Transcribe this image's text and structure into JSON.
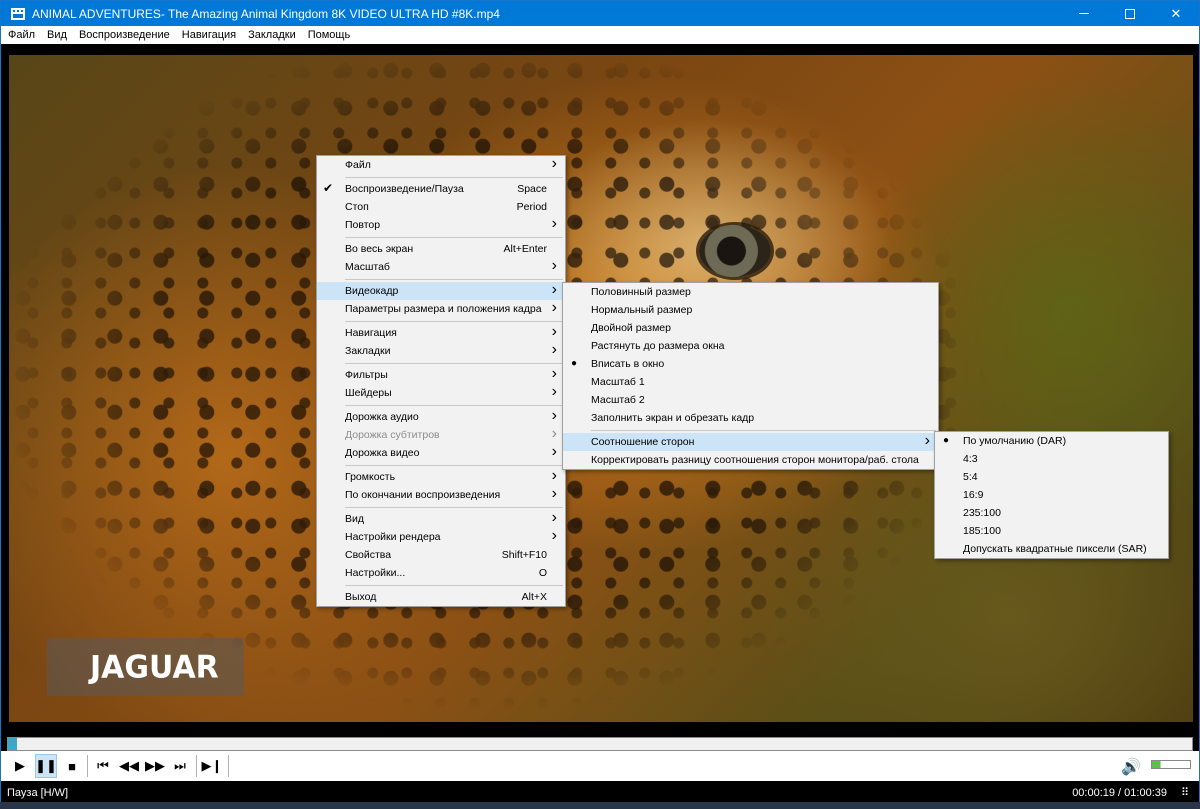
{
  "window": {
    "title": "ANIMAL ADVENTURES- The Amazing Animal Kingdom 8K VIDEO ULTRA HD #8K.mp4"
  },
  "menubar": [
    "Файл",
    "Вид",
    "Воспроизведение",
    "Навигация",
    "Закладки",
    "Помощь"
  ],
  "video": {
    "caption": "JAGUAR"
  },
  "main_menu": [
    {
      "label": "Файл",
      "submenu": true
    },
    {
      "divider": true
    },
    {
      "label": "Воспроизведение/Пауза",
      "shortcut": "Space",
      "checked": true
    },
    {
      "label": "Стоп",
      "shortcut": "Period"
    },
    {
      "label": "Повтор",
      "submenu": true
    },
    {
      "divider": true
    },
    {
      "label": "Во весь экран",
      "shortcut": "Alt+Enter"
    },
    {
      "label": "Масштаб",
      "submenu": true
    },
    {
      "divider": true
    },
    {
      "label": "Видеокадр",
      "submenu": true,
      "highlighted": true
    },
    {
      "label": "Параметры размера и положения кадра",
      "submenu": true
    },
    {
      "divider": true
    },
    {
      "label": "Навигация",
      "submenu": true
    },
    {
      "label": "Закладки",
      "submenu": true
    },
    {
      "divider": true
    },
    {
      "label": "Фильтры",
      "submenu": true
    },
    {
      "label": "Шейдеры",
      "submenu": true
    },
    {
      "divider": true
    },
    {
      "label": "Дорожка аудио",
      "submenu": true
    },
    {
      "label": "Дорожка субтитров",
      "submenu": true,
      "disabled": true
    },
    {
      "label": "Дорожка видео",
      "submenu": true
    },
    {
      "divider": true
    },
    {
      "label": "Громкость",
      "submenu": true
    },
    {
      "label": "По окончании воспроизведения",
      "submenu": true
    },
    {
      "divider": true
    },
    {
      "label": "Вид",
      "submenu": true
    },
    {
      "label": "Настройки рендера",
      "submenu": true
    },
    {
      "label": "Свойства",
      "shortcut": "Shift+F10"
    },
    {
      "label": "Настройки...",
      "shortcut": "O"
    },
    {
      "divider": true
    },
    {
      "label": "Выход",
      "shortcut": "Alt+X"
    }
  ],
  "video_menu": [
    {
      "label": "Половинный размер"
    },
    {
      "label": "Нормальный размер"
    },
    {
      "label": "Двойной размер"
    },
    {
      "label": "Растянуть до размера окна"
    },
    {
      "label": "Вписать в окно",
      "selected": true
    },
    {
      "label": "Масштаб 1"
    },
    {
      "label": "Масштаб 2"
    },
    {
      "label": "Заполнить экран и обрезать кадр"
    },
    {
      "divider": true
    },
    {
      "label": "Соотношение сторон",
      "submenu": true,
      "highlighted": true
    },
    {
      "label": "Корректировать разницу соотношения сторон монитора/раб. стола"
    }
  ],
  "aspect_menu": [
    {
      "label": "По умолчанию (DAR)",
      "selected": true
    },
    {
      "label": "4:3"
    },
    {
      "label": "5:4"
    },
    {
      "label": "16:9"
    },
    {
      "label": "235:100"
    },
    {
      "label": "185:100"
    },
    {
      "label": "Допускать квадратные пиксели (SAR)"
    }
  ],
  "playback": {
    "progress": 0.008,
    "volume": 0.22,
    "paused": true
  },
  "status": {
    "state": "Пауза [H/W]",
    "time": "00:00:19 / 01:00:39"
  }
}
